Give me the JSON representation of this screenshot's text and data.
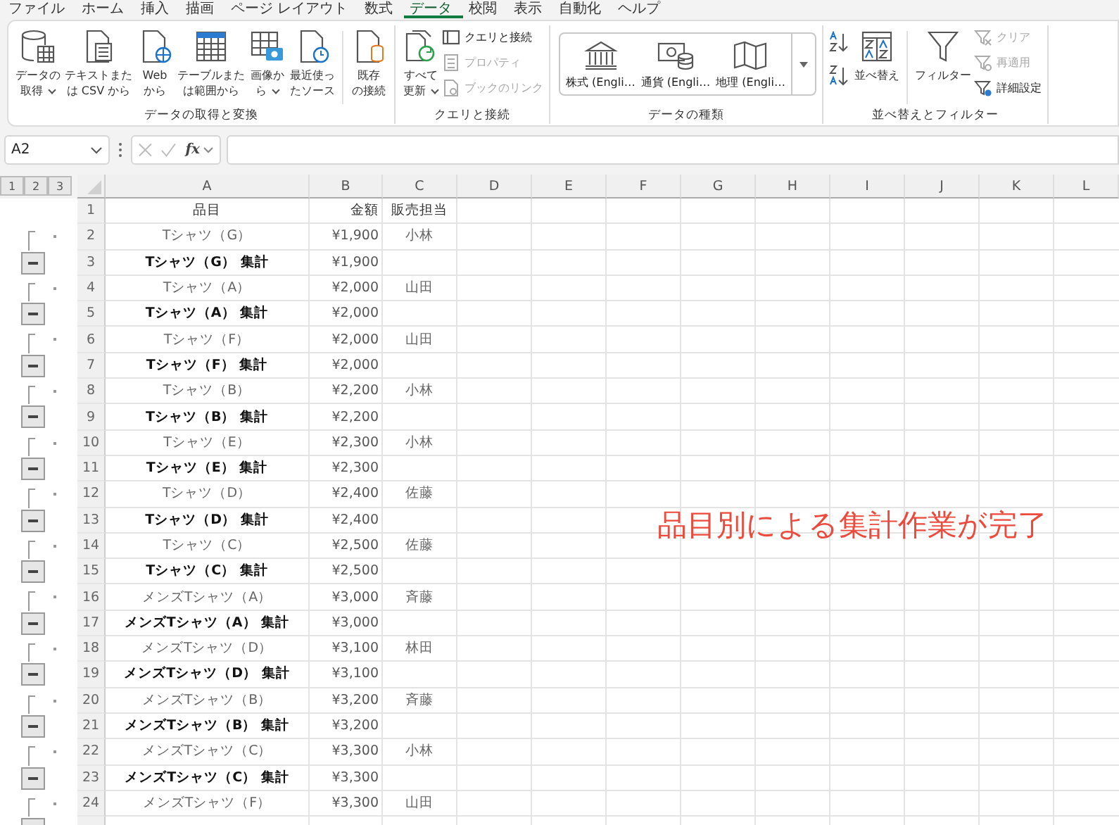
{
  "menu_tabs": [
    {
      "label": "ファイル",
      "selected": false
    },
    {
      "label": "ホーム",
      "selected": false
    },
    {
      "label": "挿入",
      "selected": false
    },
    {
      "label": "描画",
      "selected": false
    },
    {
      "label": "ページ レイアウト",
      "selected": false
    },
    {
      "label": "数式",
      "selected": false
    },
    {
      "label": "データ",
      "selected": true
    },
    {
      "label": "校閲",
      "selected": false
    },
    {
      "label": "表示",
      "selected": false
    },
    {
      "label": "自動化",
      "selected": false
    },
    {
      "label": "ヘルプ",
      "selected": false
    }
  ],
  "ribbon_groups": [
    {
      "label": "データの取得と変換",
      "items": [
        {
          "kind": "large",
          "lines": [
            "データの",
            "取得"
          ],
          "dropdown": true
        },
        {
          "kind": "large",
          "lines": [
            "テキストまた",
            "は CSV から"
          ],
          "dropdown": false
        },
        {
          "kind": "large",
          "lines": [
            "Web",
            "から"
          ],
          "dropdown": false
        },
        {
          "kind": "large",
          "lines": [
            "テーブルまた",
            "は範囲から"
          ],
          "dropdown": false
        },
        {
          "kind": "large",
          "lines": [
            "画像か",
            "ら"
          ],
          "dropdown": true
        },
        {
          "kind": "large",
          "lines": [
            "最近使っ",
            "たソース"
          ],
          "dropdown": false
        },
        {
          "kind": "large",
          "lines": [
            "既存",
            "の接続"
          ],
          "dropdown": false
        }
      ]
    },
    {
      "label": "クエリと接続",
      "items": [
        {
          "kind": "large",
          "lines": [
            "すべて",
            "更新"
          ],
          "dropdown": true
        },
        {
          "kind": "small",
          "label": "クエリと接続",
          "disabled": false
        },
        {
          "kind": "small",
          "label": "プロパティ",
          "disabled": true
        },
        {
          "kind": "small",
          "label": "ブックのリンク",
          "disabled": true
        }
      ]
    },
    {
      "label": "データの種類",
      "items": [
        {
          "kind": "gallery",
          "label": "株式 (Engli…"
        },
        {
          "kind": "gallery",
          "label": "通貨 (Engli…"
        },
        {
          "kind": "gallery",
          "label": "地理 (Engli…"
        }
      ]
    },
    {
      "label": "並べ替えとフィルター",
      "items": [
        {
          "kind": "sort"
        },
        {
          "kind": "large",
          "lines": [
            "並べ替え"
          ],
          "dropdown": false
        },
        {
          "kind": "large",
          "lines": [
            "フィルター"
          ],
          "dropdown": false
        },
        {
          "kind": "small",
          "label": "クリア",
          "disabled": true
        },
        {
          "kind": "small",
          "label": "再適用",
          "disabled": true
        },
        {
          "kind": "small",
          "label": "詳細設定",
          "disabled": false
        }
      ]
    }
  ],
  "formula_bar": {
    "name_box": "A2",
    "function_button": "fx"
  },
  "sheet": {
    "outline_levels": [
      "1",
      "2",
      "3"
    ],
    "columns": [
      "A",
      "B",
      "C",
      "D",
      "E",
      "F",
      "G",
      "H",
      "I",
      "J",
      "K",
      "L"
    ],
    "header_row": {
      "number": "1",
      "cells": [
        "品目",
        "金額",
        "販売担当"
      ]
    },
    "groups": [
      {
        "expanded": true,
        "detail": {
          "number": "2",
          "item": "Tシャツ（G）",
          "amount": "¥1,900",
          "staff": "小林"
        },
        "total": {
          "number": "3",
          "item": "Tシャツ（G） 集計",
          "amount": "¥1,900"
        }
      },
      {
        "expanded": true,
        "detail": {
          "number": "4",
          "item": "Tシャツ（A）",
          "amount": "¥2,000",
          "staff": "山田"
        },
        "total": {
          "number": "5",
          "item": "Tシャツ（A） 集計",
          "amount": "¥2,000"
        }
      },
      {
        "expanded": true,
        "detail": {
          "number": "6",
          "item": "Tシャツ（F）",
          "amount": "¥2,000",
          "staff": "山田"
        },
        "total": {
          "number": "7",
          "item": "Tシャツ（F） 集計",
          "amount": "¥2,000"
        }
      },
      {
        "expanded": true,
        "detail": {
          "number": "8",
          "item": "Tシャツ（B）",
          "amount": "¥2,200",
          "staff": "小林"
        },
        "total": {
          "number": "9",
          "item": "Tシャツ（B） 集計",
          "amount": "¥2,200"
        }
      },
      {
        "expanded": true,
        "detail": {
          "number": "10",
          "item": "Tシャツ（E）",
          "amount": "¥2,300",
          "staff": "小林"
        },
        "total": {
          "number": "11",
          "item": "Tシャツ（E） 集計",
          "amount": "¥2,300"
        }
      },
      {
        "expanded": true,
        "detail": {
          "number": "12",
          "item": "Tシャツ（D）",
          "amount": "¥2,400",
          "staff": "佐藤"
        },
        "total": {
          "number": "13",
          "item": "Tシャツ（D） 集計",
          "amount": "¥2,400"
        }
      },
      {
        "expanded": true,
        "detail": {
          "number": "14",
          "item": "Tシャツ（C）",
          "amount": "¥2,500",
          "staff": "佐藤"
        },
        "total": {
          "number": "15",
          "item": "Tシャツ（C） 集計",
          "amount": "¥2,500"
        }
      },
      {
        "expanded": true,
        "detail": {
          "number": "16",
          "item": "メンズTシャツ（A）",
          "amount": "¥3,000",
          "staff": "斉藤"
        },
        "total": {
          "number": "17",
          "item": "メンズTシャツ（A） 集計",
          "amount": "¥3,000"
        }
      },
      {
        "expanded": true,
        "detail": {
          "number": "18",
          "item": "メンズTシャツ（D）",
          "amount": "¥3,100",
          "staff": "林田"
        },
        "total": {
          "number": "19",
          "item": "メンズTシャツ（D） 集計",
          "amount": "¥3,100"
        }
      },
      {
        "expanded": true,
        "detail": {
          "number": "20",
          "item": "メンズTシャツ（B）",
          "amount": "¥3,200",
          "staff": "斉藤"
        },
        "total": {
          "number": "21",
          "item": "メンズTシャツ（B） 集計",
          "amount": "¥3,200"
        }
      },
      {
        "expanded": true,
        "detail": {
          "number": "22",
          "item": "メンズTシャツ（C）",
          "amount": "¥3,300",
          "staff": "小林"
        },
        "total": {
          "number": "23",
          "item": "メンズTシャツ（C） 集計",
          "amount": "¥3,300"
        }
      },
      {
        "expanded": true,
        "detail": {
          "number": "24",
          "item": "メンズTシャツ（F）",
          "amount": "¥3,300",
          "staff": "山田"
        }
      }
    ]
  },
  "annotation": {
    "text": "品目別による集計作業が完了"
  }
}
